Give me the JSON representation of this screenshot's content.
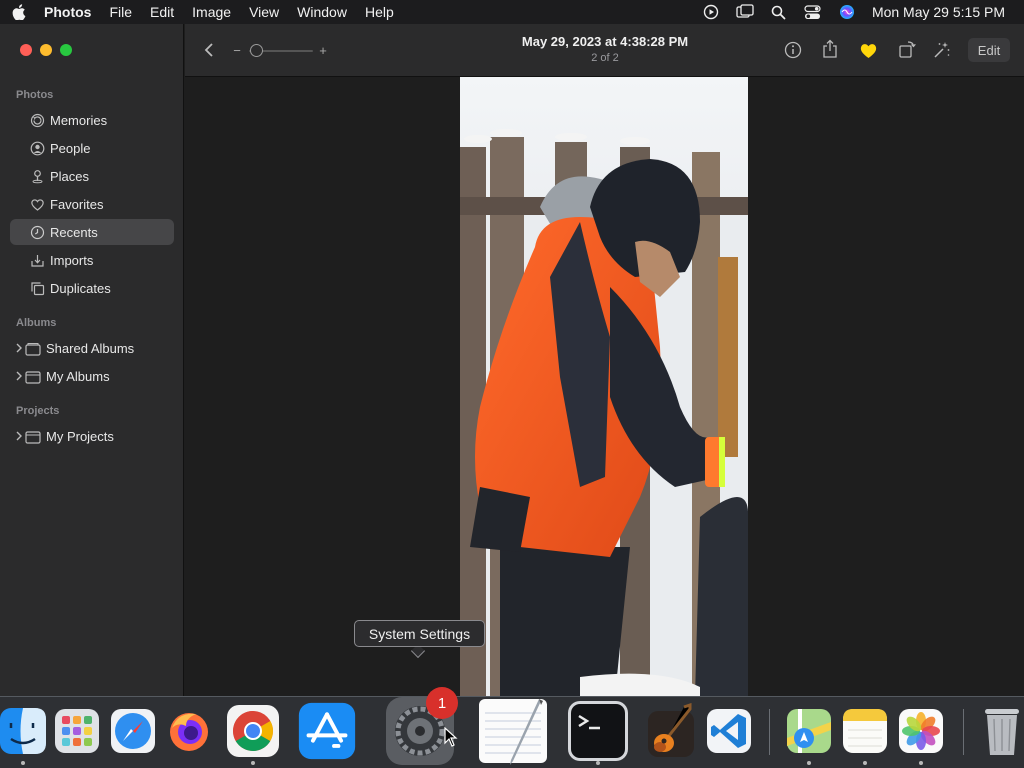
{
  "menubar": {
    "app_name": "Photos",
    "items": [
      "File",
      "Edit",
      "Image",
      "View",
      "Window",
      "Help"
    ],
    "clock": "Mon May 29  5:15 PM"
  },
  "sidebar": {
    "sections": [
      {
        "label": "Photos"
      },
      {
        "label": "Albums"
      },
      {
        "label": "Projects"
      }
    ],
    "library_items": [
      {
        "label": "Memories",
        "icon": "memories-icon"
      },
      {
        "label": "People",
        "icon": "people-icon"
      },
      {
        "label": "Places",
        "icon": "places-icon"
      },
      {
        "label": "Favorites",
        "icon": "heart-icon"
      },
      {
        "label": "Recents",
        "icon": "clock-icon",
        "selected": true
      },
      {
        "label": "Imports",
        "icon": "import-icon"
      },
      {
        "label": "Duplicates",
        "icon": "duplicates-icon"
      }
    ],
    "album_items": [
      {
        "label": "Shared Albums",
        "icon": "shared-albums-icon"
      },
      {
        "label": "My Albums",
        "icon": "folder-icon"
      }
    ],
    "project_items": [
      {
        "label": "My Projects",
        "icon": "folder-icon"
      }
    ]
  },
  "toolbar": {
    "title": "May 29, 2023 at 4:38:28 PM",
    "subtitle": "2 of 2",
    "edit_label": "Edit",
    "zoom_minus": "−",
    "zoom_plus": "+",
    "favorite_color": "#ffd60a"
  },
  "tooltip": {
    "text": "System Settings"
  },
  "dock": {
    "apps": [
      {
        "name": "Finder",
        "running": true
      },
      {
        "name": "Launchpad",
        "running": false
      },
      {
        "name": "Safari",
        "running": false
      },
      {
        "name": "Firefox",
        "running": false
      },
      {
        "name": "Google Chrome",
        "running": true
      },
      {
        "name": "App Store",
        "running": false
      },
      {
        "name": "System Settings",
        "running": false,
        "badge": "1"
      },
      {
        "name": "TextEdit",
        "running": false
      },
      {
        "name": "Terminal",
        "running": true
      },
      {
        "name": "GarageBand",
        "running": false
      },
      {
        "name": "Visual Studio Code",
        "running": false
      },
      {
        "name": "Maps",
        "running": true
      },
      {
        "name": "Notes",
        "running": true
      },
      {
        "name": "Photos",
        "running": true
      },
      {
        "name": "Trash",
        "running": false
      }
    ]
  }
}
